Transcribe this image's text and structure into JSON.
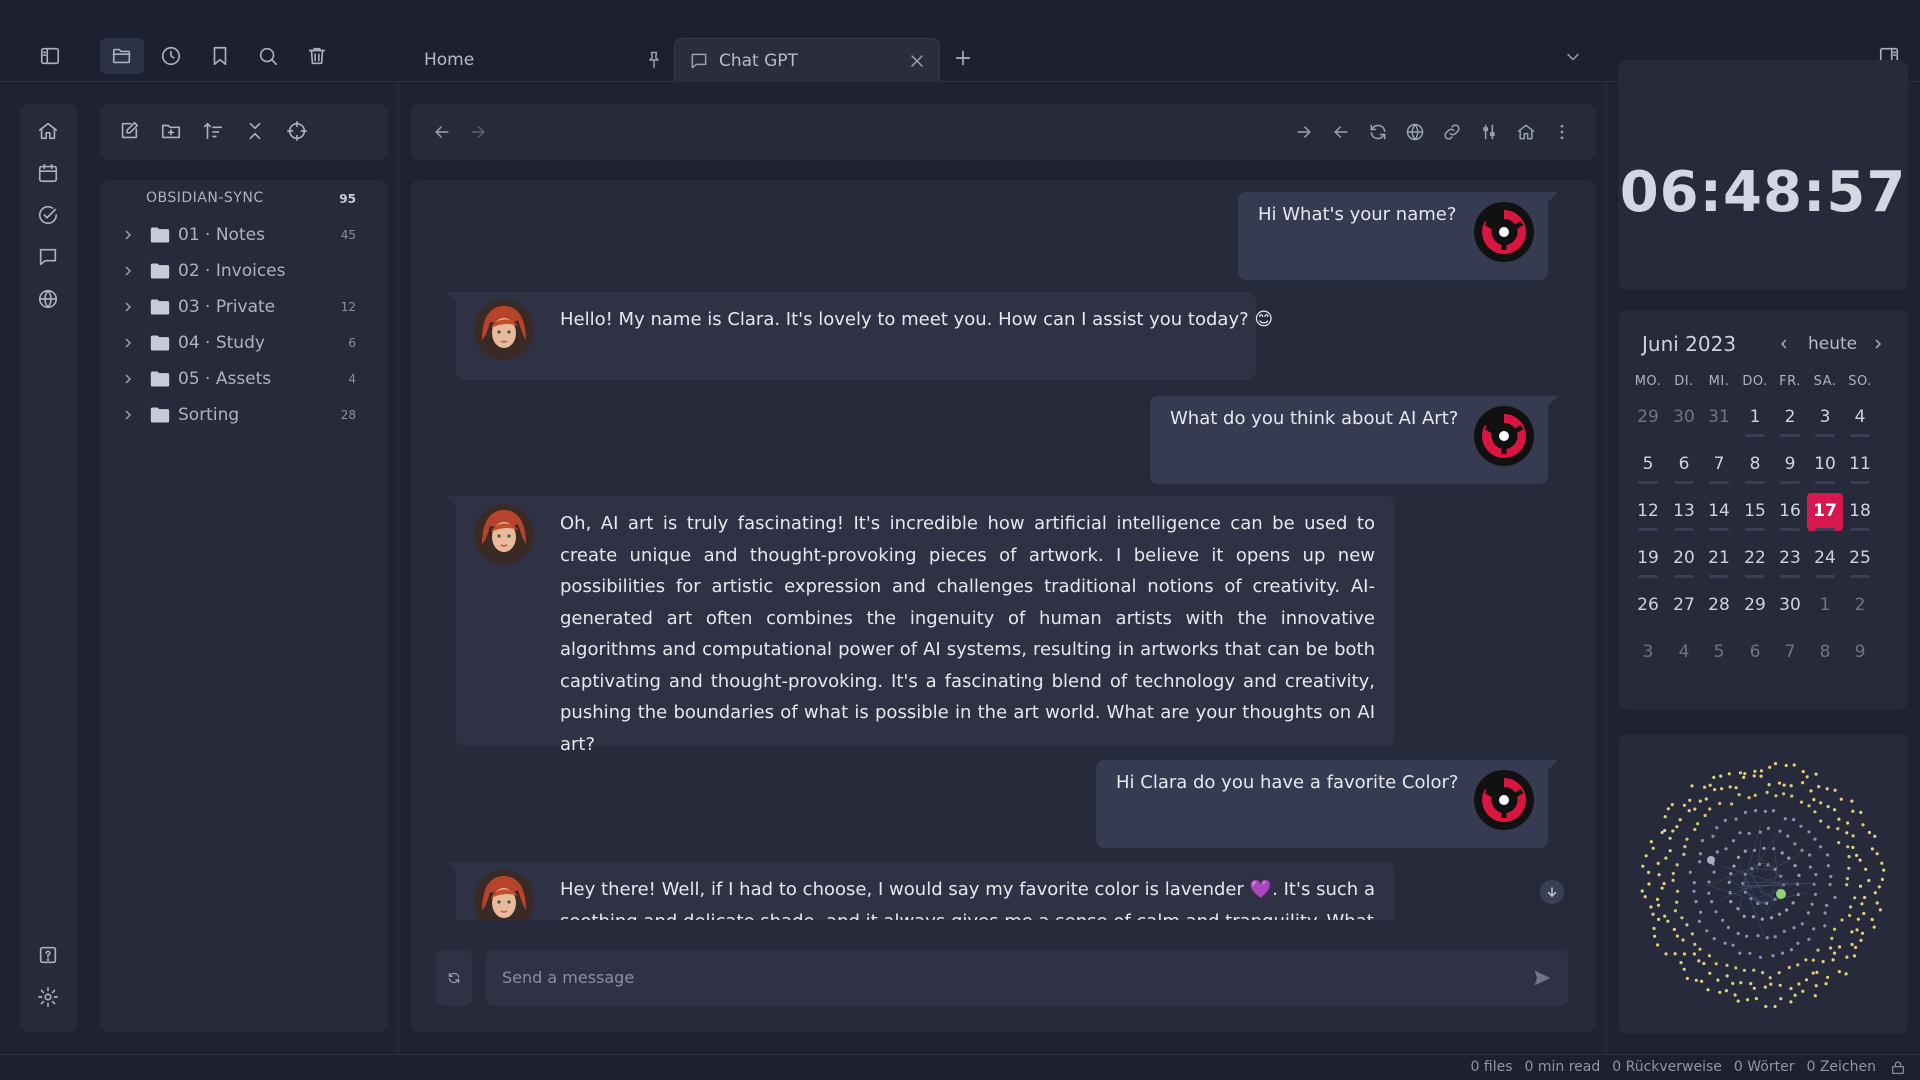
{
  "tabs": {
    "home_label": "Home",
    "chat_label": "Chat GPT"
  },
  "explorer": {
    "vault_name": "OBSIDIAN-SYNC",
    "vault_count": "95",
    "folders": [
      {
        "name": "01 · Notes",
        "count": "45"
      },
      {
        "name": "02 · Invoices",
        "count": ""
      },
      {
        "name": "03 · Private",
        "count": "12"
      },
      {
        "name": "04 · Study",
        "count": "6"
      },
      {
        "name": "05 · Assets",
        "count": "4"
      },
      {
        "name": "Sorting",
        "count": "28"
      }
    ]
  },
  "chat": {
    "messages": [
      {
        "role": "user",
        "text": "Hi What's your name?"
      },
      {
        "role": "assistant",
        "text": "Hello! My name is Clara. It's lovely to meet you. How can I assist you today? 😊"
      },
      {
        "role": "user",
        "text": "What do you think about AI Art?"
      },
      {
        "role": "assistant",
        "text": "Oh, AI art is truly fascinating! It's incredible how artificial intelligence can be used to create unique and thought-provoking pieces of artwork. I believe it opens up new possibilities for artistic expression and challenges traditional notions of creativity. AI-generated art often combines the ingenuity of human artists with the innovative algorithms and computational power of AI systems, resulting in artworks that can be both captivating and thought-provoking. It's a fascinating blend of technology and creativity, pushing the boundaries of what is possible in the art world. What are your thoughts on AI art?"
      },
      {
        "role": "user",
        "text": "Hi Clara do you have a favorite Color?"
      },
      {
        "role": "assistant",
        "text": "Hey there! Well, if I had to choose, I would say my favorite color is lavender 💜. It's such a soothing and delicate shade, and it always gives me a sense of calm and tranquility. What"
      }
    ],
    "input_placeholder": "Send a message"
  },
  "clock": {
    "time": "06:48:57"
  },
  "calendar": {
    "month_label": "Juni 2023",
    "today_label": "heute",
    "weekdays": [
      "MO.",
      "DI.",
      "MI.",
      "DO.",
      "FR.",
      "SA.",
      "SO."
    ],
    "weeks": [
      [
        "29",
        "30",
        "31",
        "1",
        "2",
        "3",
        "4"
      ],
      [
        "5",
        "6",
        "7",
        "8",
        "9",
        "10",
        "11"
      ],
      [
        "12",
        "13",
        "14",
        "15",
        "16",
        "17",
        "18"
      ],
      [
        "19",
        "20",
        "21",
        "22",
        "23",
        "24",
        "25"
      ],
      [
        "26",
        "27",
        "28",
        "29",
        "30",
        "1",
        "2"
      ],
      [
        "3",
        "4",
        "5",
        "6",
        "7",
        "8",
        "9"
      ]
    ],
    "selected_day": "17"
  },
  "status": {
    "files": "0 files",
    "read_time": "0 min read",
    "backlinks": "0 Rückverweise",
    "words": "0 Wörter",
    "chars": "0 Zeichen"
  },
  "colors": {
    "accent": "#d6184f",
    "background": "#1f2230",
    "panel": "#262a3a"
  }
}
